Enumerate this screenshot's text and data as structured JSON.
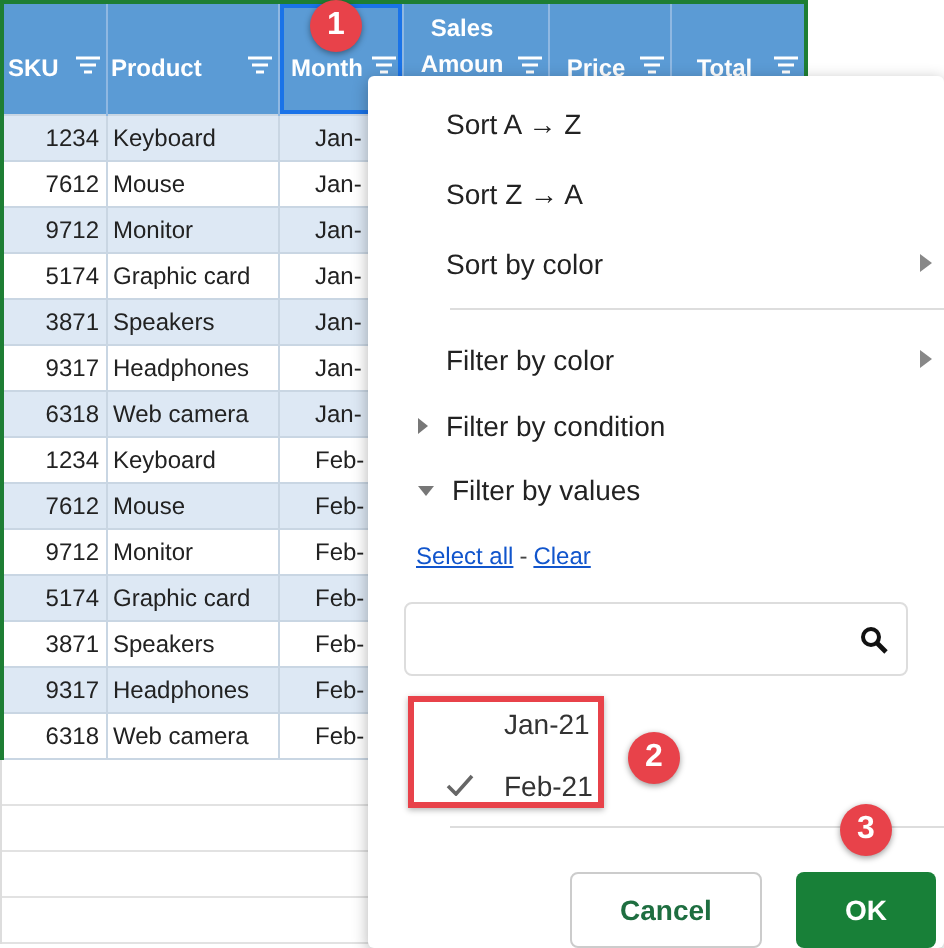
{
  "table": {
    "columns": [
      {
        "label": "SKU",
        "selected": false
      },
      {
        "label": "Product",
        "selected": false
      },
      {
        "label": "Month",
        "selected": true
      },
      {
        "label": "Sales Amoun",
        "selected": false
      },
      {
        "label": "Price",
        "selected": false
      },
      {
        "label": "Total",
        "selected": false
      }
    ],
    "rows": [
      {
        "sku": "1234",
        "product": "Keyboard",
        "month": "Jan-"
      },
      {
        "sku": "7612",
        "product": "Mouse",
        "month": "Jan-"
      },
      {
        "sku": "9712",
        "product": "Monitor",
        "month": "Jan-"
      },
      {
        "sku": "5174",
        "product": "Graphic card",
        "month": "Jan-"
      },
      {
        "sku": "3871",
        "product": "Speakers",
        "month": "Jan-"
      },
      {
        "sku": "9317",
        "product": "Headphones",
        "month": "Jan-"
      },
      {
        "sku": "6318",
        "product": "Web camera",
        "month": "Jan-"
      },
      {
        "sku": "1234",
        "product": "Keyboard",
        "month": "Feb-"
      },
      {
        "sku": "7612",
        "product": "Mouse",
        "month": "Feb-"
      },
      {
        "sku": "9712",
        "product": "Monitor",
        "month": "Feb-"
      },
      {
        "sku": "5174",
        "product": "Graphic card",
        "month": "Feb-"
      },
      {
        "sku": "3871",
        "product": "Speakers",
        "month": "Feb-"
      },
      {
        "sku": "9317",
        "product": "Headphones",
        "month": "Feb-"
      },
      {
        "sku": "6318",
        "product": "Web camera",
        "month": "Feb-"
      }
    ]
  },
  "filter_menu": {
    "items": [
      {
        "label": "Sort A → Z",
        "kind": "plain"
      },
      {
        "label": "Sort Z → A",
        "kind": "plain"
      },
      {
        "label": "Sort by color",
        "kind": "submenu"
      },
      {
        "kind": "separator"
      },
      {
        "label": "Filter by color",
        "kind": "submenu"
      },
      {
        "label": "Filter by condition",
        "kind": "section",
        "expanded": false
      },
      {
        "label": "Filter by values",
        "kind": "section",
        "expanded": true
      }
    ],
    "select_all": "Select all",
    "dash": "-",
    "clear": "Clear",
    "values": [
      {
        "label": "Jan-21",
        "checked": false
      },
      {
        "label": "Feb-21",
        "checked": true
      }
    ],
    "buttons": [
      {
        "label": "Cancel",
        "kind": "secondary"
      },
      {
        "label": "OK",
        "kind": "primary"
      }
    ]
  },
  "callouts": [
    "1",
    "2",
    "3"
  ]
}
